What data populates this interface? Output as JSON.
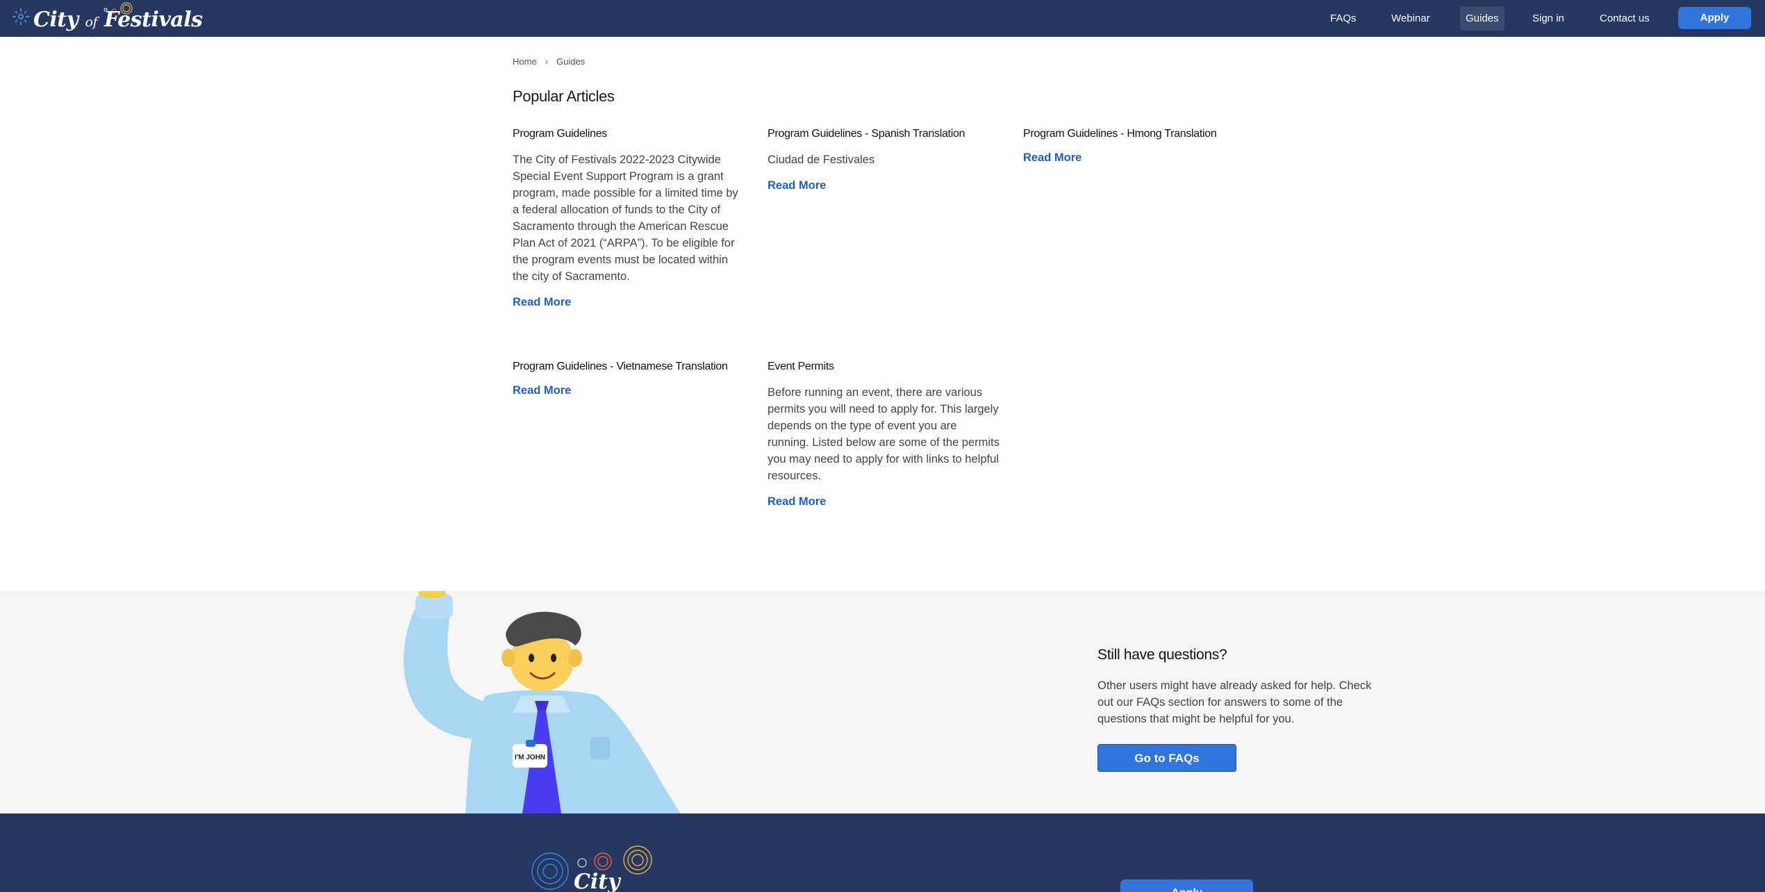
{
  "header": {
    "logo_main": "City",
    "logo_of": "of",
    "logo_end": "Festivals",
    "nav": [
      {
        "label": "FAQs"
      },
      {
        "label": "Webinar"
      },
      {
        "label": "Guides"
      },
      {
        "label": "Sign in"
      },
      {
        "label": "Contact us"
      }
    ],
    "apply_label": "Apply"
  },
  "breadcrumb": {
    "home": "Home",
    "current": "Guides"
  },
  "main": {
    "title": "Popular Articles",
    "articles": [
      {
        "title": "Program Guidelines",
        "desc": "The City of Festivals 2022-2023 Citywide Special Event Support Program is a grant program, made possible for a limited time by a federal allocation of funds to the City of Sacramento through the American Rescue Plan Act of 2021 (“ARPA”). To be eligible for the program events must be located within the city of Sacramento.",
        "read_more": "Read More"
      },
      {
        "title": "Program Guidelines - Spanish Translation",
        "desc": "Ciudad de Festivales",
        "read_more": "Read More"
      },
      {
        "title": "Program Guidelines - Hmong Translation",
        "read_more": "Read More"
      },
      {
        "title": "Program Guidelines - Vietnamese Translation",
        "read_more": "Read More"
      },
      {
        "title": "Event Permits",
        "desc": "Before running an event, there are various permits you will need to apply for. This largely depends on the type of event you are running. Listed below are some of the permits you may need to apply for with links to helpful resources.",
        "read_more": "Read More"
      }
    ]
  },
  "questions": {
    "title": "Still have questions?",
    "text": "Other users might have already asked for help. Check out our FAQs section for answers to some of the questions that might be helpful for you.",
    "button": "Go to FAQs",
    "badge": "I'M JOHN"
  },
  "footer": {
    "logo_text": "City",
    "apply_label": "Apply"
  },
  "colors": {
    "navy": "#263862",
    "accent": "#3174de",
    "link": "#1f5fbf",
    "band": "#f5f5f5"
  }
}
